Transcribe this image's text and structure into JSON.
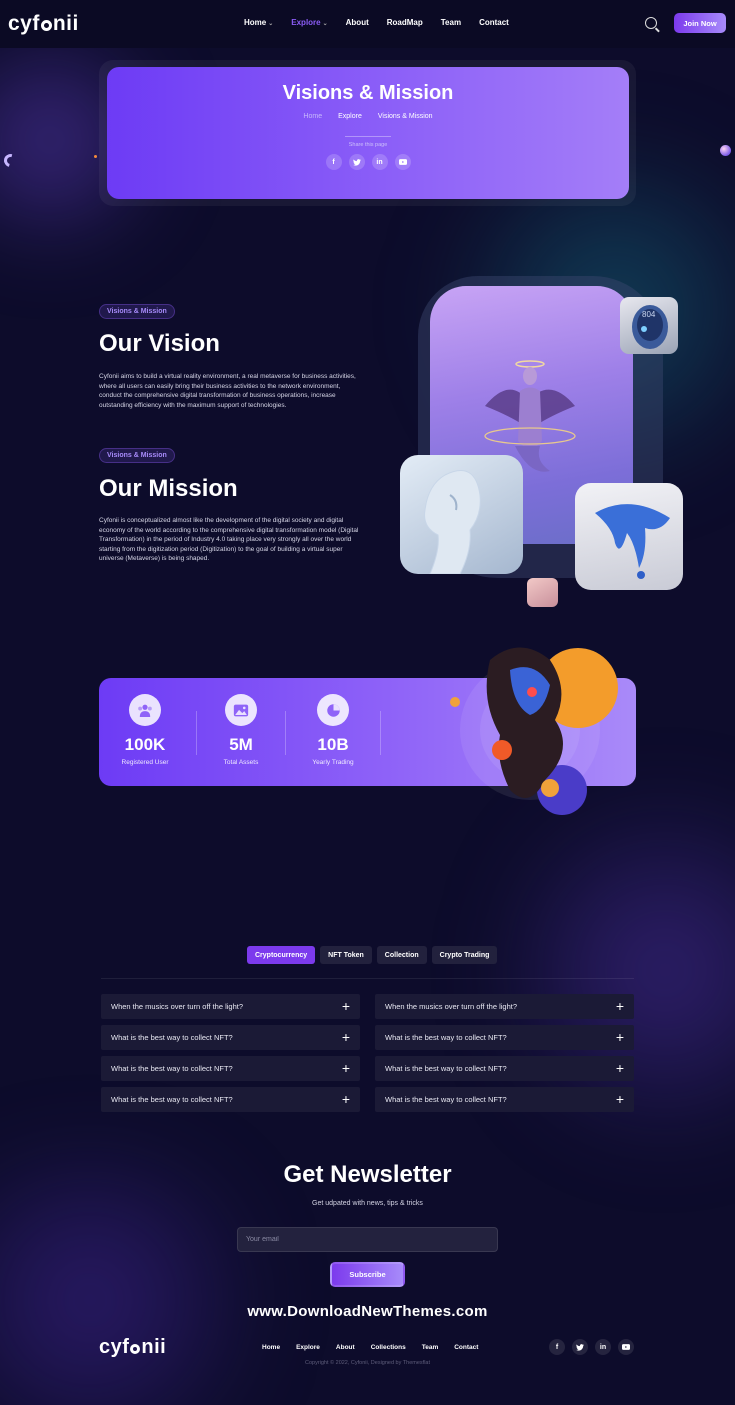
{
  "brand": {
    "logo": "cyfonii"
  },
  "header": {
    "nav": [
      {
        "label": "Home",
        "has_dropdown": true,
        "active": false
      },
      {
        "label": "Explore",
        "has_dropdown": true,
        "active": true
      },
      {
        "label": "About",
        "has_dropdown": false,
        "active": false
      },
      {
        "label": "RoadMap",
        "has_dropdown": false,
        "active": false
      },
      {
        "label": "Team",
        "has_dropdown": false,
        "active": false
      },
      {
        "label": "Contact",
        "has_dropdown": false,
        "active": false
      }
    ],
    "join_label": "Join Now",
    "accent_color": "#8b5cf6"
  },
  "hero": {
    "title": "Visions & Mission",
    "breadcrumb": [
      "Home",
      "Explore",
      "Visions & Mission"
    ],
    "share_label": "Share this page",
    "social": [
      "f",
      "t",
      "in",
      "yt"
    ]
  },
  "vision": {
    "tag": "Visions & Mission",
    "title": "Our Vision",
    "text": "Cyfonii aims to build a virtual reality environment, a real metaverse for business activities, where all users can easily bring their business activities to the network environment, conduct the comprehensive digital transformation of business operations, increase outstanding efficiency with the maximum support of technologies."
  },
  "mission": {
    "tag": "Visions & Mission",
    "title": "Our Mission",
    "text": "Cyfonii is conceptualized almost like the development of the digital society and digital economy of the world according to the comprehensive digital transformation model (Digital Transformation) in the period of Industry 4.0 taking place very strongly all over the world starting from the digitization period (Digitization) to the goal of building a virtual super universe (Metaverse) is being shaped."
  },
  "stats": [
    {
      "value": "100K",
      "label": "Registered User",
      "icon": "users-icon"
    },
    {
      "value": "5M",
      "label": "Total Assets",
      "icon": "image-icon"
    },
    {
      "value": "10B",
      "label": "Yearly Trading",
      "icon": "pie-chart-icon"
    }
  ],
  "faq": {
    "tabs": [
      {
        "label": "Cryptocurrency",
        "active": true
      },
      {
        "label": "NFT Token",
        "active": false
      },
      {
        "label": "Collection",
        "active": false
      },
      {
        "label": "Crypto Trading",
        "active": false
      }
    ],
    "left": [
      "When the musics over turn off the light?",
      "What is the best way to collect NFT?",
      "What is the best way to collect NFT?",
      "What is the best way to collect NFT?"
    ],
    "right": [
      "When the musics over turn off the light?",
      "What is the best way to collect NFT?",
      "What is the best way to collect NFT?",
      "What is the best way to collect NFT?"
    ]
  },
  "newsletter": {
    "title": "Get Newsletter",
    "subtitle": "Get udpated with news, tips & tricks",
    "placeholder": "Your email",
    "button": "Subscribe"
  },
  "watermark": "www.DownloadNewThemes.com",
  "footer": {
    "nav": [
      "Home",
      "Explore",
      "About",
      "Collections",
      "Team",
      "Contact"
    ],
    "social": [
      "f",
      "t",
      "in",
      "yt"
    ],
    "copyright": "Copyright © 2022, Cyfonii, Designed by Themesflat"
  }
}
